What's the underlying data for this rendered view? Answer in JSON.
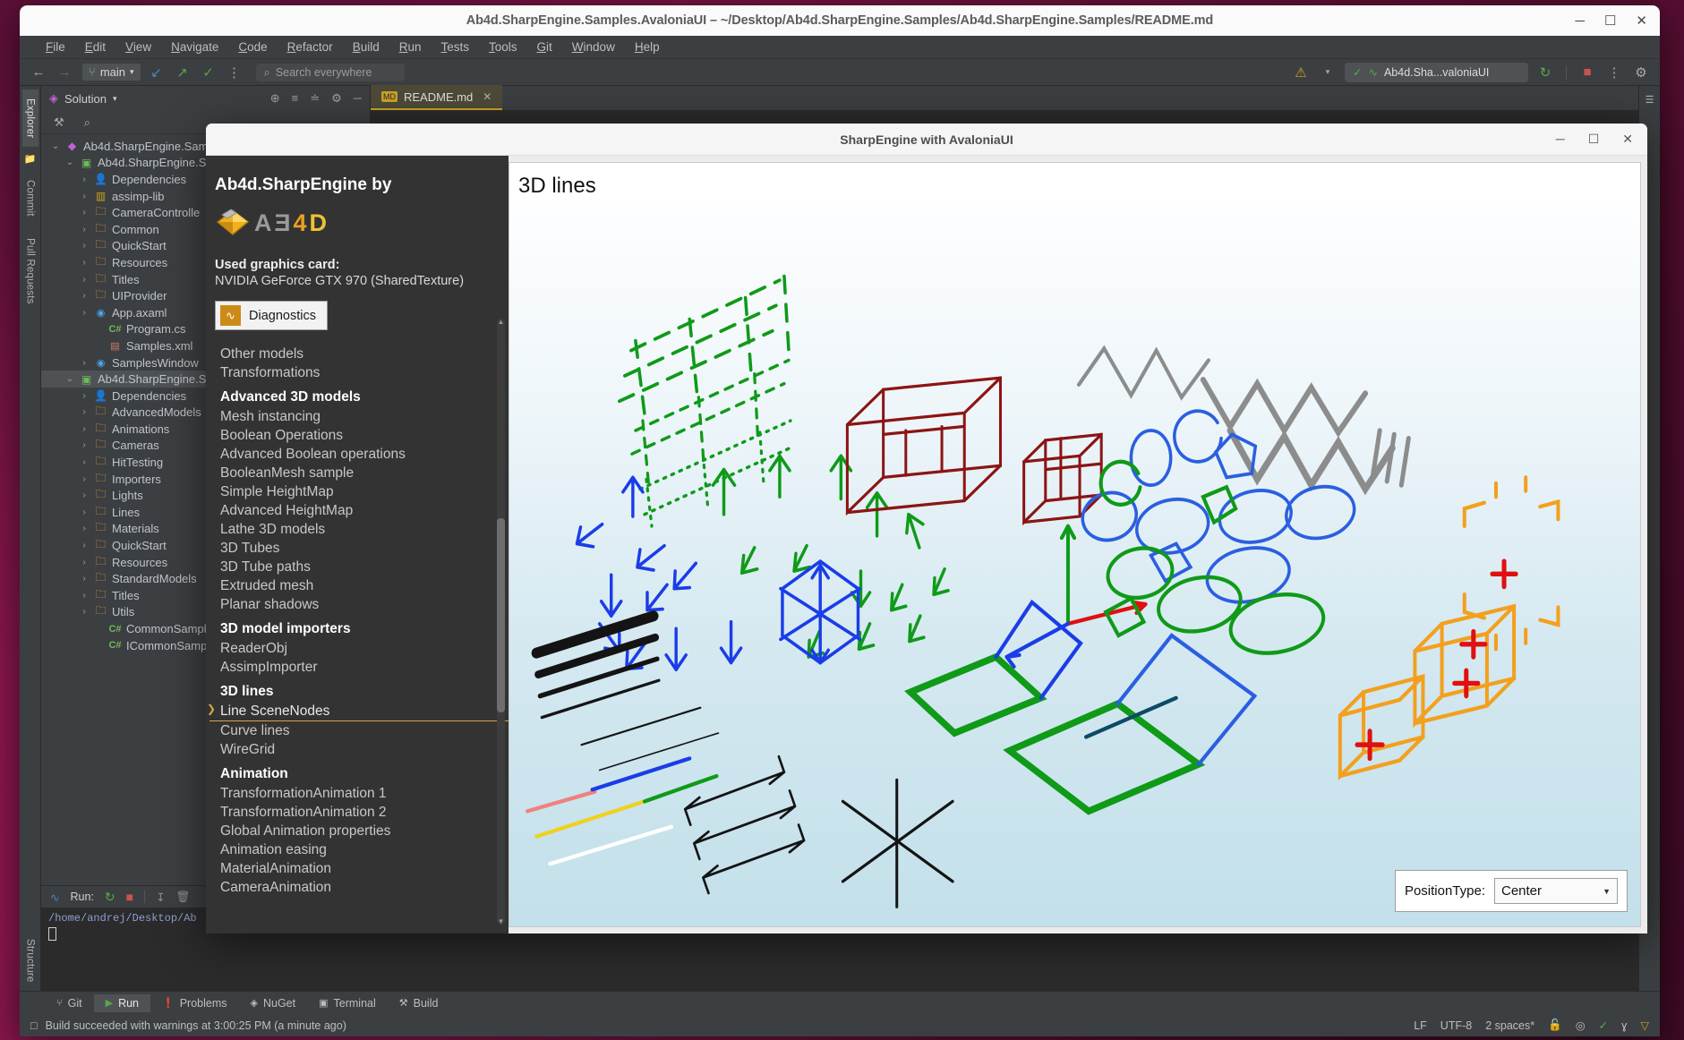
{
  "ide": {
    "title": "Ab4d.SharpEngine.Samples.AvaloniaUI – ~/Desktop/Ab4d.SharpEngine.Samples/Ab4d.SharpEngine.Samples/README.md",
    "window_buttons": {
      "minimize": "─",
      "maximize": "☐",
      "close": "✕"
    },
    "menu": [
      "File",
      "Edit",
      "View",
      "Navigate",
      "Code",
      "Refactor",
      "Build",
      "Run",
      "Tests",
      "Tools",
      "Git",
      "Window",
      "Help"
    ],
    "toolbar": {
      "back": "←",
      "forward": "→",
      "branch_icon": "⑂",
      "branch": "main",
      "branch_caret": "▾",
      "update_icon": "↙",
      "push_icon": "↗",
      "check_icon": "✓",
      "more_icon": "⋮",
      "search_icon": "⌕",
      "search_placeholder": "Search everywhere",
      "warning_icon": "⚠",
      "warning_caret": "▾",
      "run_config_icon": "∿",
      "run_config": "Ab4d.Sha...valoniaUI",
      "rerun_icon": "↻",
      "stop_icon": "■",
      "more2_icon": "⋮",
      "settings_icon": "⚙"
    },
    "left_strip": {
      "explorer": "Explorer",
      "commit": "Commit",
      "pull_requests": "Pull Requests",
      "structure": "Structure"
    },
    "project_panel": {
      "header_icon": "◈",
      "header": "Solution",
      "header_caret": "▾",
      "header_icons": [
        "⊕",
        "≡",
        "≐",
        "⚙",
        "─"
      ],
      "sub_icons": [
        "⚒",
        "⌕"
      ],
      "tree": [
        {
          "indent": 0,
          "chevron": "⌄",
          "icon": "sln",
          "label": "Ab4d.SharpEngine.Sam",
          "selected": false
        },
        {
          "indent": 1,
          "chevron": "⌄",
          "icon": "proj",
          "label": "Ab4d.SharpEngine.S",
          "selected": false
        },
        {
          "indent": 2,
          "chevron": "›",
          "icon": "dep",
          "label": "Dependencies",
          "selected": false
        },
        {
          "indent": 2,
          "chevron": "›",
          "icon": "lib",
          "label": "assimp-lib",
          "selected": false
        },
        {
          "indent": 2,
          "chevron": "›",
          "icon": "folder",
          "label": "CameraControlle",
          "selected": false
        },
        {
          "indent": 2,
          "chevron": "›",
          "icon": "folder",
          "label": "Common",
          "selected": false
        },
        {
          "indent": 2,
          "chevron": "›",
          "icon": "folder",
          "label": "QuickStart",
          "selected": false
        },
        {
          "indent": 2,
          "chevron": "›",
          "icon": "folder",
          "label": "Resources",
          "selected": false
        },
        {
          "indent": 2,
          "chevron": "›",
          "icon": "folder",
          "label": "Titles",
          "selected": false
        },
        {
          "indent": 2,
          "chevron": "›",
          "icon": "folder",
          "label": "UIProvider",
          "selected": false
        },
        {
          "indent": 2,
          "chevron": "›",
          "icon": "axaml",
          "label": "App.axaml",
          "selected": false
        },
        {
          "indent": 3,
          "chevron": "",
          "icon": "cs",
          "label": "Program.cs",
          "selected": false
        },
        {
          "indent": 3,
          "chevron": "",
          "icon": "xml",
          "label": "Samples.xml",
          "selected": false
        },
        {
          "indent": 2,
          "chevron": "›",
          "icon": "axaml",
          "label": "SamplesWindow",
          "selected": false
        },
        {
          "indent": 1,
          "chevron": "⌄",
          "icon": "proj",
          "label": "Ab4d.SharpEngine.S",
          "selected": true
        },
        {
          "indent": 2,
          "chevron": "›",
          "icon": "dep",
          "label": "Dependencies",
          "selected": false
        },
        {
          "indent": 2,
          "chevron": "›",
          "icon": "folder",
          "label": "AdvancedModels",
          "selected": false
        },
        {
          "indent": 2,
          "chevron": "›",
          "icon": "folder",
          "label": "Animations",
          "selected": false
        },
        {
          "indent": 2,
          "chevron": "›",
          "icon": "folder",
          "label": "Cameras",
          "selected": false
        },
        {
          "indent": 2,
          "chevron": "›",
          "icon": "folder",
          "label": "HitTesting",
          "selected": false
        },
        {
          "indent": 2,
          "chevron": "›",
          "icon": "folder",
          "label": "Importers",
          "selected": false
        },
        {
          "indent": 2,
          "chevron": "›",
          "icon": "folder",
          "label": "Lights",
          "selected": false
        },
        {
          "indent": 2,
          "chevron": "›",
          "icon": "folder",
          "label": "Lines",
          "selected": false
        },
        {
          "indent": 2,
          "chevron": "›",
          "icon": "folder",
          "label": "Materials",
          "selected": false
        },
        {
          "indent": 2,
          "chevron": "›",
          "icon": "folder",
          "label": "QuickStart",
          "selected": false
        },
        {
          "indent": 2,
          "chevron": "›",
          "icon": "folder",
          "label": "Resources",
          "selected": false
        },
        {
          "indent": 2,
          "chevron": "›",
          "icon": "folder",
          "label": "StandardModels",
          "selected": false
        },
        {
          "indent": 2,
          "chevron": "›",
          "icon": "folder",
          "label": "Titles",
          "selected": false
        },
        {
          "indent": 2,
          "chevron": "›",
          "icon": "folder",
          "label": "Utils",
          "selected": false
        },
        {
          "indent": 3,
          "chevron": "",
          "icon": "cs",
          "label": "CommonSample",
          "selected": false
        },
        {
          "indent": 3,
          "chevron": "",
          "icon": "cs",
          "label": "ICommonSample",
          "selected": false
        }
      ]
    },
    "run_panel": {
      "icon": "∿",
      "label": "Run:",
      "rerun_icon": "↻",
      "stop_icon": "■",
      "scroll_icon": "↧",
      "trash_icon": "🗑",
      "output": "/home/andrej/Desktop/Ab"
    },
    "tabs": [
      {
        "icon": "MD",
        "label": "README.md",
        "close": "✕"
      }
    ],
    "tool_windows": [
      {
        "icon": "⑂",
        "label": "Git",
        "active": false
      },
      {
        "icon": "▶",
        "label": "Run",
        "active": true
      },
      {
        "icon": "❗",
        "label": "Problems",
        "active": false
      },
      {
        "icon": "◈",
        "label": "NuGet",
        "active": false
      },
      {
        "icon": "▣",
        "label": "Terminal",
        "active": false
      },
      {
        "icon": "⚒",
        "label": "Build",
        "active": false
      }
    ],
    "status": {
      "icon": "□",
      "message": "Build succeeded with warnings at 3:00:25 PM  (a minute ago)",
      "line_sep": "LF",
      "encoding": "UTF-8",
      "indent": "2 spaces*",
      "lock_icon": "🔓",
      "inspect_icon": "◎",
      "check_icon": "✓",
      "branch_icon": "ɣ",
      "caret_icon": "▽"
    }
  },
  "sharpengine": {
    "window_title": "SharpEngine with AvaloniaUI",
    "window_buttons": {
      "minimize": "─",
      "maximize": "☐",
      "close": "✕"
    },
    "panel": {
      "title": "Ab4d.SharpEngine by",
      "logo_text_a": "A",
      "logo_text_b": "Ǝ",
      "logo_text_4": "4",
      "logo_text_d": "D",
      "gfx_header": "Used graphics card:",
      "gfx_value": "NVIDIA GeForce GTX 970 (SharedTexture)",
      "diagnostics_button": "Diagnostics",
      "diagnostics_icon": "∿",
      "scroll_up": "▲",
      "scroll_down": "▼",
      "items": [
        {
          "type": "item",
          "label": "Other models"
        },
        {
          "type": "item",
          "label": "Transformations"
        },
        {
          "type": "group",
          "label": "Advanced 3D models"
        },
        {
          "type": "item",
          "label": "Mesh instancing"
        },
        {
          "type": "item",
          "label": "Boolean Operations"
        },
        {
          "type": "item",
          "label": "Advanced Boolean operations"
        },
        {
          "type": "item",
          "label": "BooleanMesh sample"
        },
        {
          "type": "item",
          "label": "Simple HeightMap"
        },
        {
          "type": "item",
          "label": "Advanced HeightMap"
        },
        {
          "type": "item",
          "label": "Lathe 3D models"
        },
        {
          "type": "item",
          "label": "3D Tubes"
        },
        {
          "type": "item",
          "label": "3D Tube paths"
        },
        {
          "type": "item",
          "label": "Extruded mesh"
        },
        {
          "type": "item",
          "label": "Planar shadows"
        },
        {
          "type": "group",
          "label": "3D model importers"
        },
        {
          "type": "item",
          "label": "ReaderObj"
        },
        {
          "type": "item",
          "label": "AssimpImporter"
        },
        {
          "type": "group",
          "label": "3D lines"
        },
        {
          "type": "item",
          "label": "Line SceneNodes",
          "selected": true
        },
        {
          "type": "item",
          "label": "Curve lines"
        },
        {
          "type": "item",
          "label": "WireGrid"
        },
        {
          "type": "group",
          "label": "Animation"
        },
        {
          "type": "item",
          "label": "TransformationAnimation 1"
        },
        {
          "type": "item",
          "label": "TransformationAnimation 2"
        },
        {
          "type": "item",
          "label": "Global Animation properties"
        },
        {
          "type": "item",
          "label": "Animation easing"
        },
        {
          "type": "item",
          "label": "MaterialAnimation"
        },
        {
          "type": "item",
          "label": "CameraAnimation"
        }
      ]
    },
    "content": {
      "heading": "3D lines",
      "position_type_label": "PositionType:",
      "position_type_value": "Center",
      "position_type_caret": "▼"
    },
    "colors": {
      "accent": "#d9a441",
      "line_green": "#0f9a18",
      "line_darkred": "#8c1414",
      "line_blue": "#1a3de8",
      "line_royal": "#2b5fe0",
      "line_orange": "#f2a01e",
      "line_gray": "#8c8c8c",
      "line_black": "#141414",
      "line_red": "#e01010",
      "line_yellow": "#f0d020"
    }
  }
}
